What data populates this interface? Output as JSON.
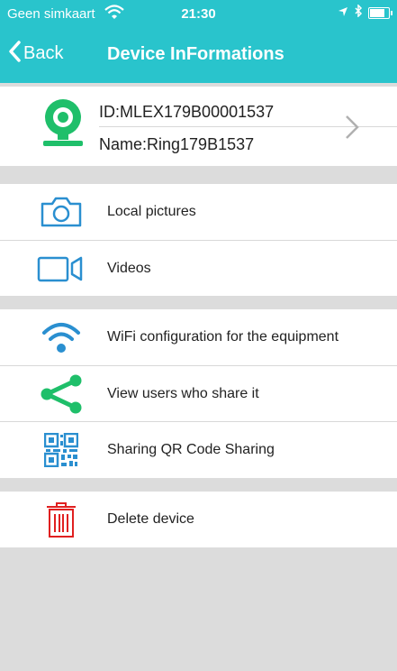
{
  "status_bar": {
    "carrier": "Geen simkaart",
    "time": "21:30"
  },
  "nav": {
    "back_label": "Back",
    "title": "Device InFormations"
  },
  "device": {
    "id": "ID:MLEX179B00001537",
    "name": "Name:Ring179B1537"
  },
  "menu": {
    "local_pictures": "Local pictures",
    "videos": "Videos",
    "wifi_config": "WiFi configuration for the equipment",
    "view_users": "View users who share it",
    "qr_sharing": "Sharing QR Code Sharing",
    "delete_device": "Delete device"
  },
  "colors": {
    "accent": "#29c4cc",
    "icon_green": "#1fbf6a",
    "icon_blue": "#2a8fd0",
    "delete_red": "#e02020"
  }
}
